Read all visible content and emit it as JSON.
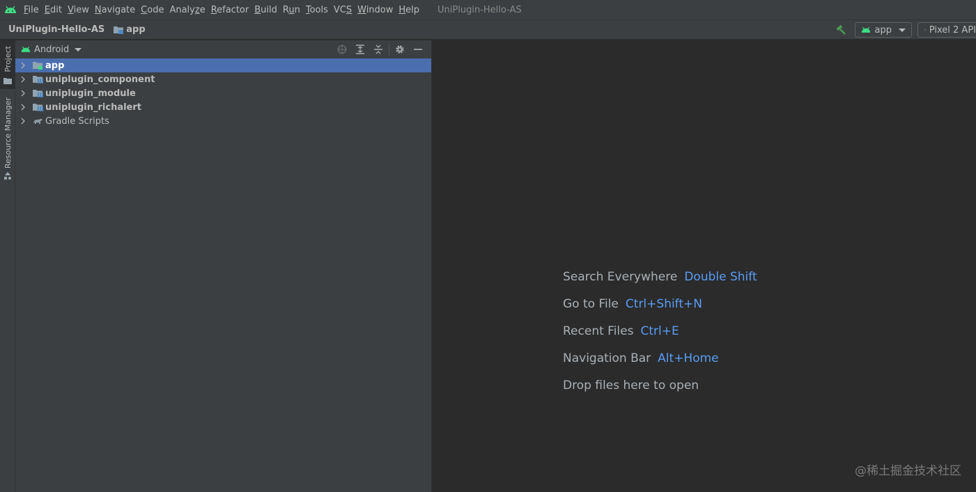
{
  "menubar": {
    "items": [
      {
        "pre": "",
        "mn": "F",
        "post": "ile"
      },
      {
        "pre": "",
        "mn": "E",
        "post": "dit"
      },
      {
        "pre": "",
        "mn": "V",
        "post": "iew"
      },
      {
        "pre": "",
        "mn": "N",
        "post": "avigate"
      },
      {
        "pre": "",
        "mn": "C",
        "post": "ode"
      },
      {
        "pre": "Analy",
        "mn": "z",
        "post": "e"
      },
      {
        "pre": "",
        "mn": "R",
        "post": "efactor"
      },
      {
        "pre": "",
        "mn": "B",
        "post": "uild"
      },
      {
        "pre": "R",
        "mn": "u",
        "post": "n"
      },
      {
        "pre": "",
        "mn": "T",
        "post": "ools"
      },
      {
        "pre": "VC",
        "mn": "S",
        "post": ""
      },
      {
        "pre": "",
        "mn": "W",
        "post": "indow"
      },
      {
        "pre": "",
        "mn": "H",
        "post": "elp"
      }
    ],
    "window_title": "UniPlugin-Hello-AS"
  },
  "navbar": {
    "project": "UniPlugin-Hello-AS",
    "module": "app",
    "run_config": "app",
    "device": "Pixel 2 API"
  },
  "toolstrip": {
    "project_tab": "Project",
    "resource_tab": "Resource Manager"
  },
  "project_panel": {
    "view_mode": "Android",
    "tree": [
      {
        "label": "app",
        "kind": "app-module",
        "selected": true,
        "bold": true
      },
      {
        "label": "uniplugin_component",
        "kind": "library-module",
        "selected": false,
        "bold": true
      },
      {
        "label": "uniplugin_module",
        "kind": "library-module",
        "selected": false,
        "bold": true
      },
      {
        "label": "uniplugin_richalert",
        "kind": "library-module",
        "selected": false,
        "bold": true
      },
      {
        "label": "Gradle Scripts",
        "kind": "gradle",
        "selected": false,
        "bold": false
      }
    ]
  },
  "editor": {
    "hints": [
      {
        "action": "Search Everywhere",
        "shortcut": "Double Shift"
      },
      {
        "action": "Go to File",
        "shortcut": "Ctrl+Shift+N"
      },
      {
        "action": "Recent Files",
        "shortcut": "Ctrl+E"
      },
      {
        "action": "Navigation Bar",
        "shortcut": "Alt+Home"
      },
      {
        "action": "Drop files here to open",
        "shortcut": ""
      }
    ],
    "watermark": "@稀土掘金技术社区"
  },
  "colors": {
    "android_green": "#3ddc84",
    "selection": "#4b6eaf",
    "shortcut_blue": "#589df6"
  }
}
